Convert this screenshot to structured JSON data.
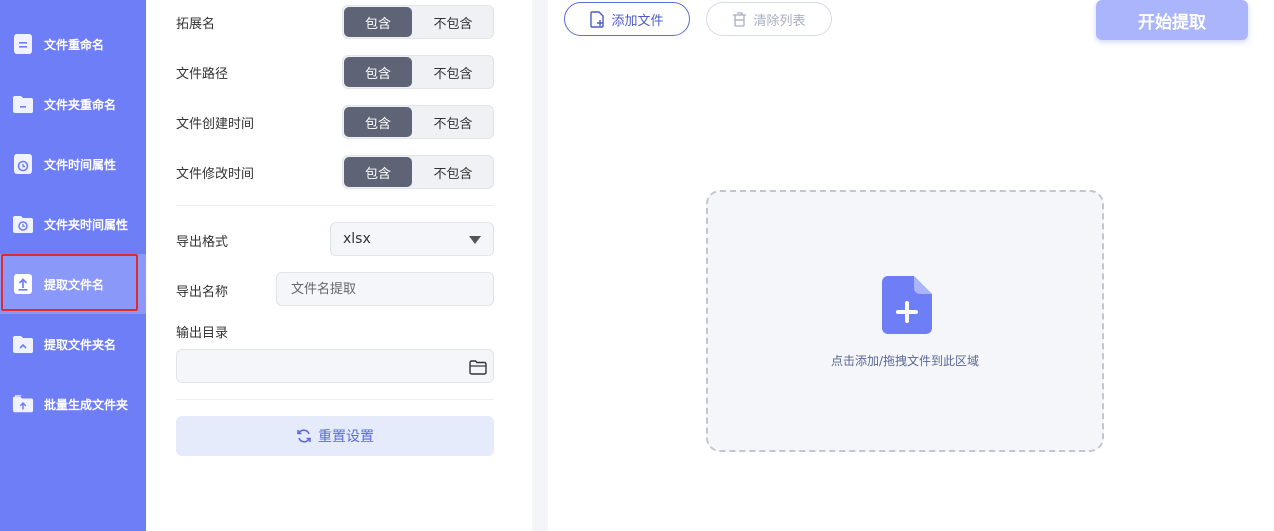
{
  "sidebar": {
    "items": [
      {
        "label": "文件重命名",
        "icon": "document-icon"
      },
      {
        "label": "文件夹重命名",
        "icon": "folder-minus-icon"
      },
      {
        "label": "文件时间属性",
        "icon": "file-clock-icon"
      },
      {
        "label": "文件夹时间属性",
        "icon": "folder-clock-icon"
      },
      {
        "label": "提取文件名",
        "icon": "file-upload-icon"
      },
      {
        "label": "提取文件夹名",
        "icon": "folder-upload-icon"
      },
      {
        "label": "批量生成文件夹",
        "icon": "folder-plus-icon"
      }
    ],
    "active_index": 4
  },
  "settings": {
    "rows": [
      {
        "label": "拓展名",
        "on": "包含",
        "off": "不包含"
      },
      {
        "label": "文件路径",
        "on": "包含",
        "off": "不包含"
      },
      {
        "label": "文件创建时间",
        "on": "包含",
        "off": "不包含"
      },
      {
        "label": "文件修改时间",
        "on": "包含",
        "off": "不包含"
      }
    ],
    "export_format_label": "导出格式",
    "export_format_value": "xlsx",
    "export_name_label": "导出名称",
    "export_name_placeholder": "文件名提取",
    "output_dir_label": "输出目录",
    "output_dir_value": "",
    "reset_label": "重置设置"
  },
  "toolbar": {
    "add_label": "添加文件",
    "clear_label": "清除列表",
    "start_label": "开始提取"
  },
  "dropzone": {
    "hint": "点击添加/拖拽文件到此区域"
  },
  "colors": {
    "sidebar": "#6d7ef7",
    "accent": "#5b6cd6",
    "highlight": "#e02b2b"
  }
}
